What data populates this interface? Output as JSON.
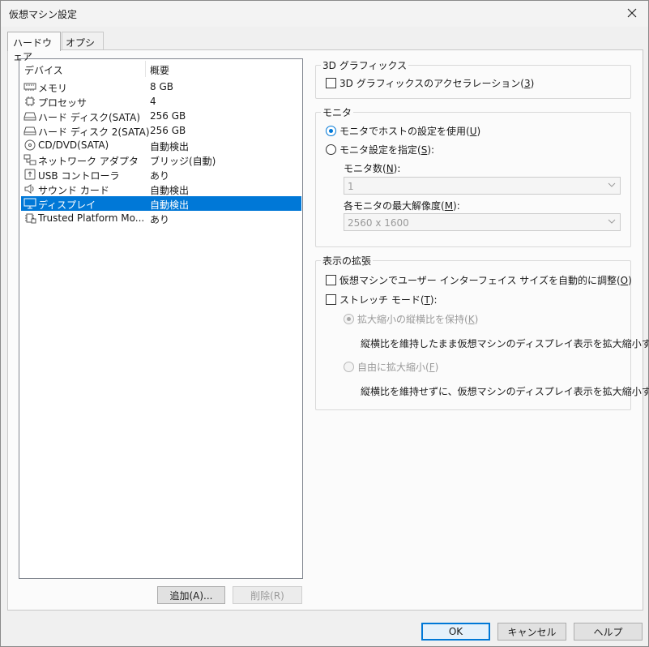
{
  "window": {
    "title": "仮想マシン設定"
  },
  "tabs": [
    {
      "label": "ハードウェア"
    },
    {
      "label": "オプション"
    }
  ],
  "device_list": {
    "columns": [
      "デバイス",
      "概要"
    ],
    "rows": [
      {
        "name": "メモリ",
        "summary": "8 GB",
        "icon": "memory-icon"
      },
      {
        "name": "プロセッサ",
        "summary": "4",
        "icon": "processor-icon"
      },
      {
        "name": "ハード ディスク(SATA)",
        "summary": "256 GB",
        "icon": "hard-disk-icon"
      },
      {
        "name": "ハード ディスク 2(SATA)",
        "summary": "256 GB",
        "icon": "hard-disk-icon"
      },
      {
        "name": "CD/DVD(SATA)",
        "summary": "自動検出",
        "icon": "cd-dvd-icon"
      },
      {
        "name": "ネットワーク アダプタ",
        "summary": "ブリッジ(自動)",
        "icon": "network-adapter-icon"
      },
      {
        "name": "USB コントローラ",
        "summary": "あり",
        "icon": "usb-icon"
      },
      {
        "name": "サウンド カード",
        "summary": "自動検出",
        "icon": "speaker-icon"
      },
      {
        "name": "ディスプレイ",
        "summary": "自動検出",
        "icon": "display-icon",
        "selected": true
      },
      {
        "name": "Trusted Platform Mo...",
        "summary": "あり",
        "icon": "tpm-chip-icon"
      }
    ]
  },
  "buttons": {
    "add": "追加(A)...",
    "remove": "削除(R)",
    "ok": "OK",
    "cancel": "キャンセル",
    "help": "ヘルプ"
  },
  "graphics_group": {
    "title": "3D グラフィックス",
    "accel_prefix": "3D グラフィックスのアクセラレーション(",
    "accel_key": "3",
    "accel_suffix": ")",
    "accel_checked": false
  },
  "monitor_group": {
    "title": "モニタ",
    "host_prefix": "モニタでホストの設定を使用(",
    "host_key": "U",
    "host_suffix": ")",
    "custom_prefix": "モニタ設定を指定(",
    "custom_key": "S",
    "custom_suffix": "):",
    "count_prefix": "モニタ数(",
    "count_key": "N",
    "count_suffix": "):",
    "count_value": "1",
    "maxres_prefix": "各モニタの最大解像度(",
    "maxres_key": "M",
    "maxres_suffix": "):",
    "maxres_value": "2560 x 1600",
    "selected": "host"
  },
  "scaling_group": {
    "title": "表示の拡張",
    "autofit_prefix": "仮想マシンでユーザー インターフェイス サイズを自動的に調整(",
    "autofit_key": "O",
    "autofit_suffix": ")",
    "stretch_prefix": "ストレッチ モード(",
    "stretch_key": "T",
    "stretch_suffix": "):",
    "keep_prefix": "拡大縮小の縦横比を保持(",
    "keep_key": "K",
    "keep_suffix": ")",
    "keep_desc": "縦横比を維持したまま仮想マシンのディスプレイ表示を拡大縮小する",
    "free_prefix": "自由に拡大縮小(",
    "free_key": "F",
    "free_suffix": ")",
    "free_desc": "縦横比を維持せずに、仮想マシンのディスプレイ表示を拡大縮小する"
  },
  "colors": {
    "accent": "#0078d7",
    "selection": "#0078d7"
  }
}
